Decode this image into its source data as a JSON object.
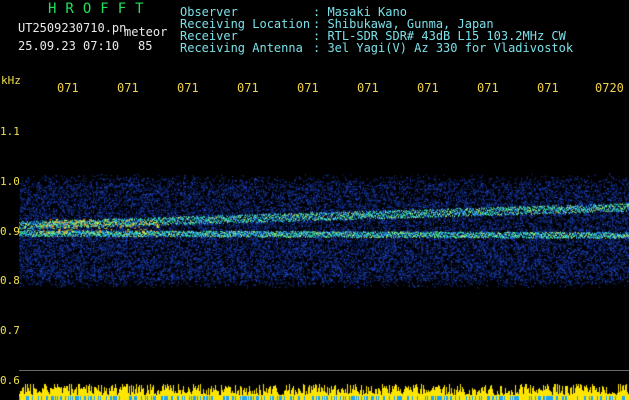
{
  "header": {
    "logo": "HROFFT",
    "filename": "UT2509230710.pn",
    "mode": "meteor",
    "timestamp": "25.09.23 07:10",
    "count": "85"
  },
  "info": {
    "labels": [
      "Observer",
      "Receiving Location",
      "Receiver",
      "Receiving Antenna"
    ],
    "values": [
      ": Masaki Kano",
      ": Shibukawa, Gunma, Japan",
      ": RTL-SDR SDR# 43dB L15 103.2MHz CW",
      ": 3el Yagi(V) Az 330 for Vladivostok"
    ]
  },
  "y_axis": {
    "unit": "kHz",
    "ticks": [
      "1.1",
      "1.0",
      "0.9",
      "0.8",
      "0.7",
      "0.6"
    ]
  },
  "time_ticks": [
    "071",
    "071",
    "071",
    "071",
    "071",
    "071",
    "071",
    "071",
    "071",
    "0720"
  ],
  "colors": {
    "background": "#000000",
    "info_text": "#7ae0e8",
    "header_text": "#eaeaea",
    "ticks": "#f0d24a",
    "logo": "#22e05a",
    "noise": "#1a3cff",
    "echo": "#3cff9a",
    "power_bar": "#ffe600"
  }
}
